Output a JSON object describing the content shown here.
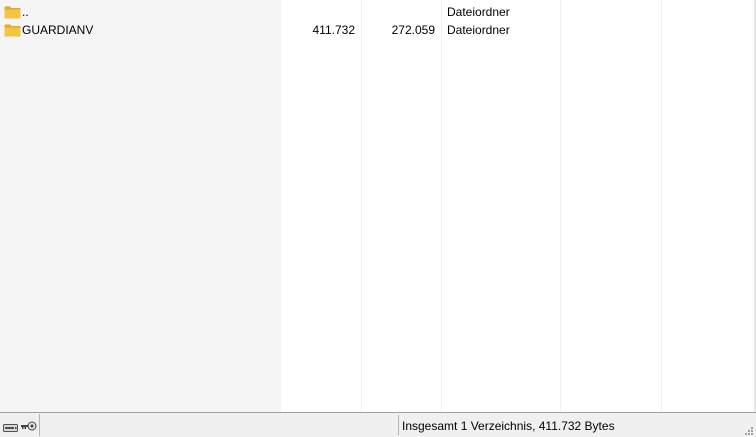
{
  "file_list": {
    "rows": [
      {
        "name": "..",
        "size": "",
        "packed": "",
        "type": "Dateiordner",
        "icon": "folder-icon"
      },
      {
        "name": "GUARDIANV",
        "size": "411.732",
        "packed": "272.059",
        "type": "Dateiordner",
        "icon": "folder-icon"
      }
    ]
  },
  "statusbar": {
    "icons": [
      "drive-icon",
      "key-icon"
    ],
    "summary": "Insgesamt 1 Verzeichnis, 411.732 Bytes"
  },
  "colors": {
    "folder": "#f4c542",
    "folder_dark": "#e0a82e",
    "name_column_bg": "#f5f5f5",
    "statusbar_bg": "#f0f0f0"
  }
}
